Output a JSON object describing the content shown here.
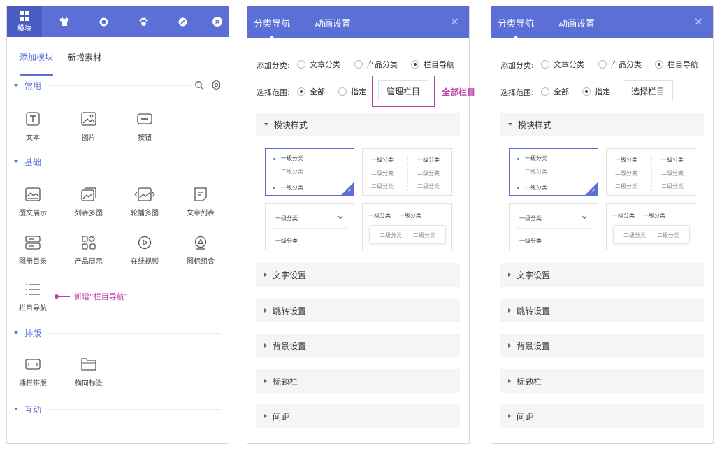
{
  "colors": {
    "accent": "#5b6fd6",
    "annotation": "#c040a8"
  },
  "left": {
    "tab_active_label": "模块",
    "top_icons": [
      "grid-icon",
      "shirt-icon",
      "gear-icon",
      "paw-icon",
      "link-icon",
      "close-icon"
    ],
    "subtabs": [
      "添加模块",
      "新增素材"
    ],
    "sections": [
      {
        "name": "常用",
        "items": [
          "文本",
          "图片",
          "按钮"
        ]
      },
      {
        "name": "基础",
        "items": [
          "图文展示",
          "列表多图",
          "轮播多图",
          "文章列表",
          "图册目录",
          "产品展示",
          "在线视频",
          "图标组合",
          "栏目导航"
        ]
      },
      {
        "name": "排版",
        "items": [
          "通栏排版",
          "横向标签"
        ]
      },
      {
        "name": "互动",
        "items": []
      }
    ],
    "annotation": "新增“栏目导航”"
  },
  "panel1": {
    "tabs": [
      "分类导航",
      "动画设置"
    ],
    "close": "×",
    "add_label": "添加分类:",
    "add_options": [
      "文章分类",
      "产品分类",
      "栏目导航"
    ],
    "add_selected": 2,
    "range_label": "选择范围:",
    "range_options": [
      "全部",
      "指定"
    ],
    "range_selected": 0,
    "button": "管理栏目",
    "callout": "全部栏目",
    "accordion": [
      "模块样式",
      "文字设置",
      "跳转设置",
      "背景设置",
      "标题栏",
      "间距"
    ]
  },
  "panel2": {
    "tabs": [
      "分类导航",
      "动画设置"
    ],
    "close": "×",
    "add_label": "添加分类:",
    "add_options": [
      "文章分类",
      "产品分类",
      "栏目导航"
    ],
    "add_selected": 2,
    "range_label": "选择范围:",
    "range_options": [
      "全部",
      "指定"
    ],
    "range_selected": 1,
    "button": "选择栏目",
    "accordion": [
      "模块样式",
      "文字设置",
      "跳转设置",
      "背景设置",
      "标题栏",
      "间距"
    ]
  },
  "style_cards": {
    "level1": "一级分类",
    "level2": "二级分类"
  }
}
